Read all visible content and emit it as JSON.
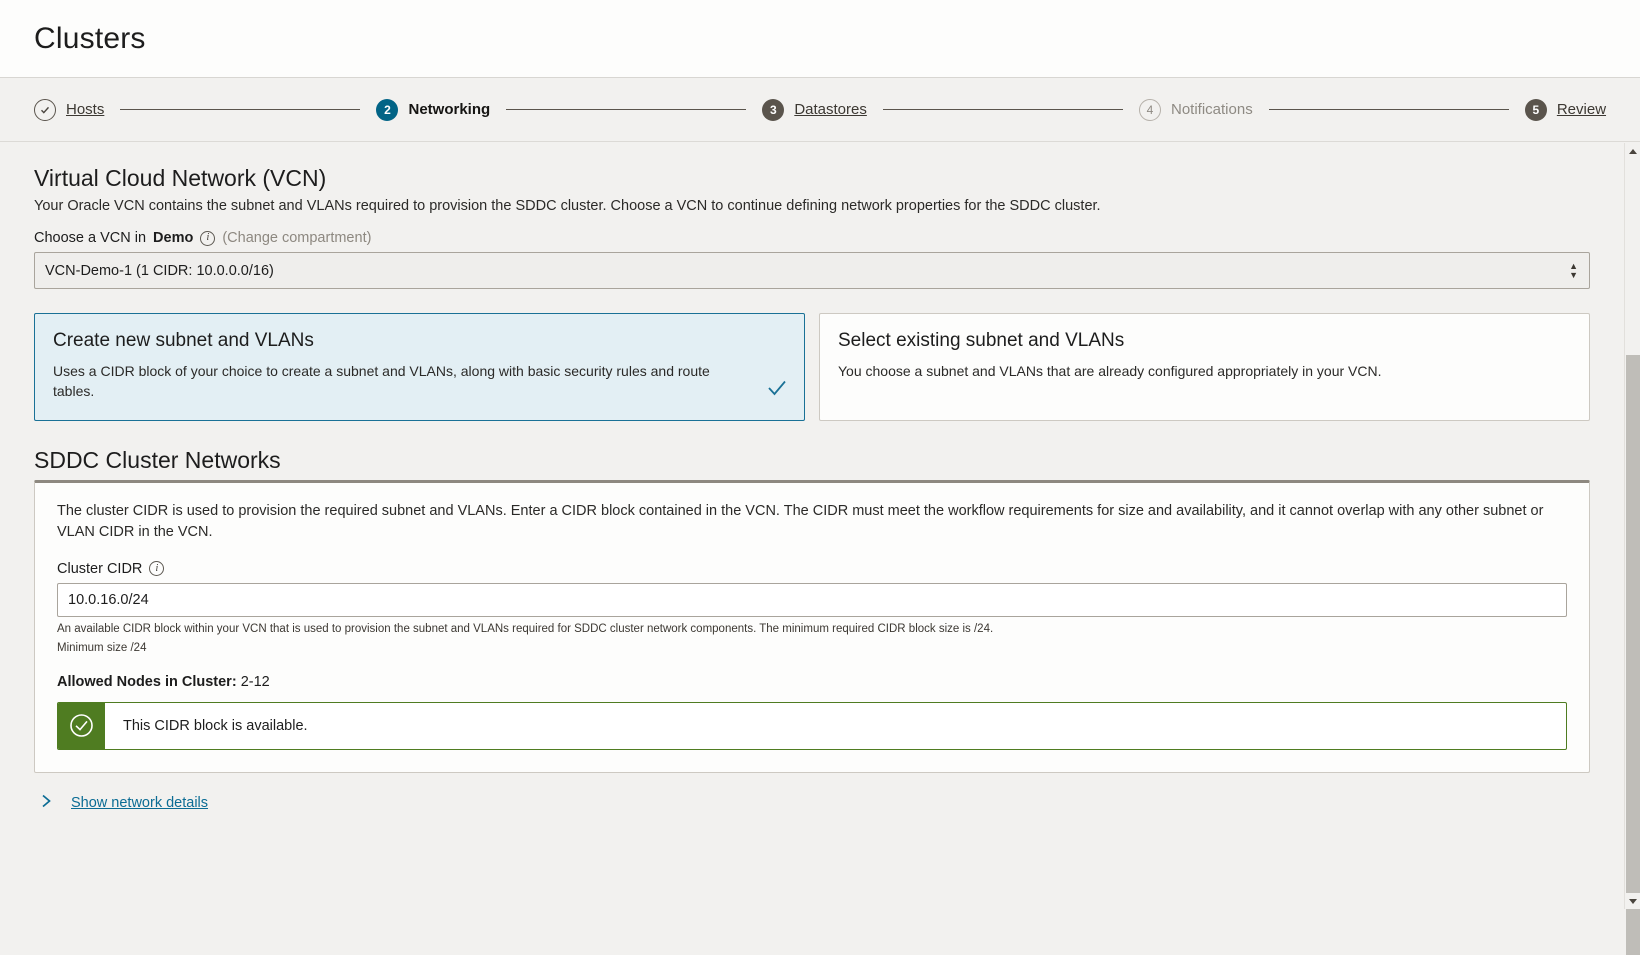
{
  "header": {
    "title": "Clusters"
  },
  "stepper": {
    "steps": [
      {
        "num": "1",
        "label": "Hosts",
        "state": "done"
      },
      {
        "num": "2",
        "label": "Networking",
        "state": "current"
      },
      {
        "num": "3",
        "label": "Datastores",
        "state": "dark"
      },
      {
        "num": "4",
        "label": "Notifications",
        "state": "muted"
      },
      {
        "num": "5",
        "label": "Review",
        "state": "dark"
      }
    ]
  },
  "vcn": {
    "title": "Virtual Cloud Network (VCN)",
    "description": "Your Oracle VCN contains the subnet and VLANs required to provision the SDDC cluster. Choose a VCN to continue defining network properties for the SDDC cluster.",
    "label_prefix": "Choose a VCN in",
    "compartment": "Demo",
    "info_icon": "info-icon",
    "change_compartment": "(Change compartment)",
    "select_value": "VCN-Demo-1 (1 CIDR: 10.0.0.0/16)",
    "select_options": [
      "VCN-Demo-1 (1 CIDR: 10.0.0.0/16)"
    ]
  },
  "options": [
    {
      "title": "Create new subnet and VLANs",
      "desc": "Uses a CIDR block of your choice to create a subnet and VLANs, along with basic security rules and route tables.",
      "selected": true,
      "check_icon": "check-icon"
    },
    {
      "title": "Select existing subnet and VLANs",
      "desc": "You choose a subnet and VLANs that are already configured appropriately in your VCN.",
      "selected": false,
      "check_icon": ""
    }
  ],
  "sddc": {
    "title": "SDDC Cluster Networks",
    "description": "The cluster CIDR is used to provision the required subnet and VLANs. Enter a CIDR block contained in the VCN. The CIDR must meet the workflow requirements for size and availability, and it cannot overlap with any other subnet or VLAN CIDR in the VCN.",
    "cidr_label": "Cluster CIDR",
    "cidr_info_icon": "info-icon",
    "cidr_value": "10.0.16.0/24",
    "cidr_placeholder": "10.0.16.0/24",
    "help_text": "An available CIDR block within your VCN that is used to provision the subnet and VLANs required for SDDC cluster network components. The minimum required CIDR block size is /24.",
    "minimum_size": "Minimum size /24",
    "allowed_label": "Allowed Nodes in Cluster:",
    "allowed_value": "2-12",
    "alert": {
      "icon": "check-circle-icon",
      "message": "This CIDR block is available.",
      "color": "#4f7c21"
    }
  },
  "footer": {
    "chevron_icon": "chevron-right-icon",
    "show_details_label": "Show network details"
  },
  "scrollbar": {
    "up_icon": "scroll-up-arrow-icon",
    "down_icon": "scroll-down-arrow-icon",
    "thumb": "scrollbar-thumb"
  },
  "colors": {
    "accent_blue": "#026486",
    "link_blue": "#0b6c94",
    "selected_border": "#1a7196",
    "selected_bg": "#e3eff4",
    "success_green": "#4f7c21",
    "page_bg": "#f2f1ef"
  }
}
